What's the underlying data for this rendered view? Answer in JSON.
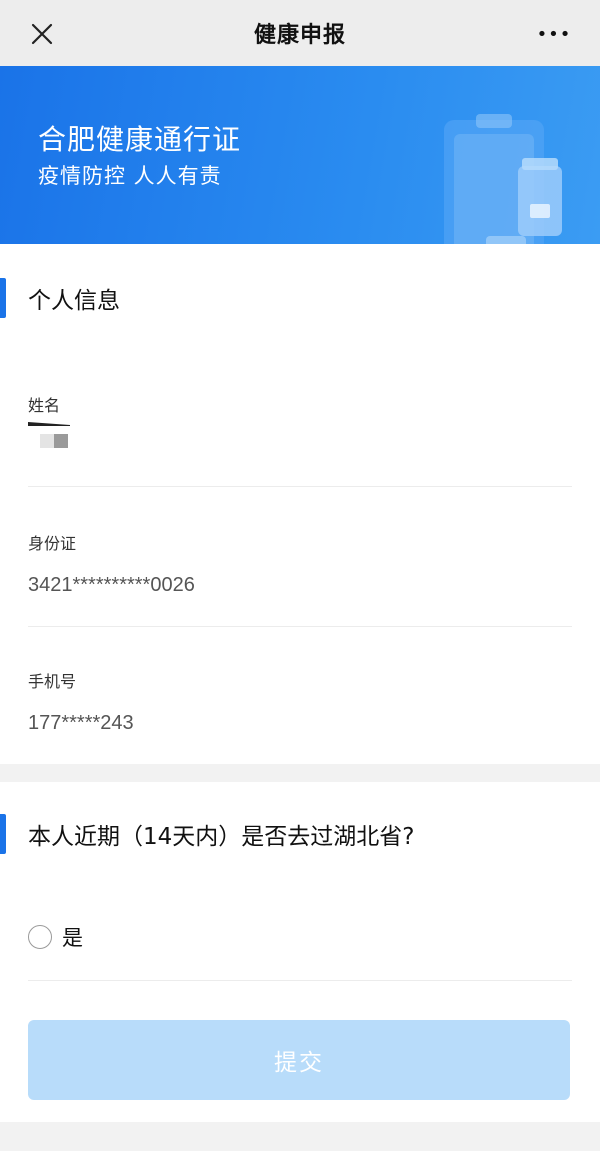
{
  "navbar": {
    "title": "健康申报",
    "close_icon": "close-icon",
    "more_icon": "more-icon",
    "more_glyph": "•••"
  },
  "banner": {
    "title": "合肥健康通行证",
    "subtitle": "疫情防控 人人有责",
    "illustration_icon": "clipboard-medicine-illustration",
    "colors": {
      "start": "#1a73e8",
      "end": "#3b9cf3"
    }
  },
  "personal_info": {
    "section_title": "个人信息",
    "fields": [
      {
        "label": "姓名",
        "value": ""
      },
      {
        "label": "身份证",
        "value": "3421**********0026"
      },
      {
        "label": "手机号",
        "value": "177*****243"
      }
    ]
  },
  "question": {
    "title": "本人近期（14天内）是否去过湖北省?",
    "options": [
      {
        "label": "是",
        "selected": false
      }
    ]
  },
  "submit": {
    "label": "提交",
    "enabled": false
  },
  "colors": {
    "accent": "#1a73e8",
    "button_disabled": "#b8dcfa"
  }
}
